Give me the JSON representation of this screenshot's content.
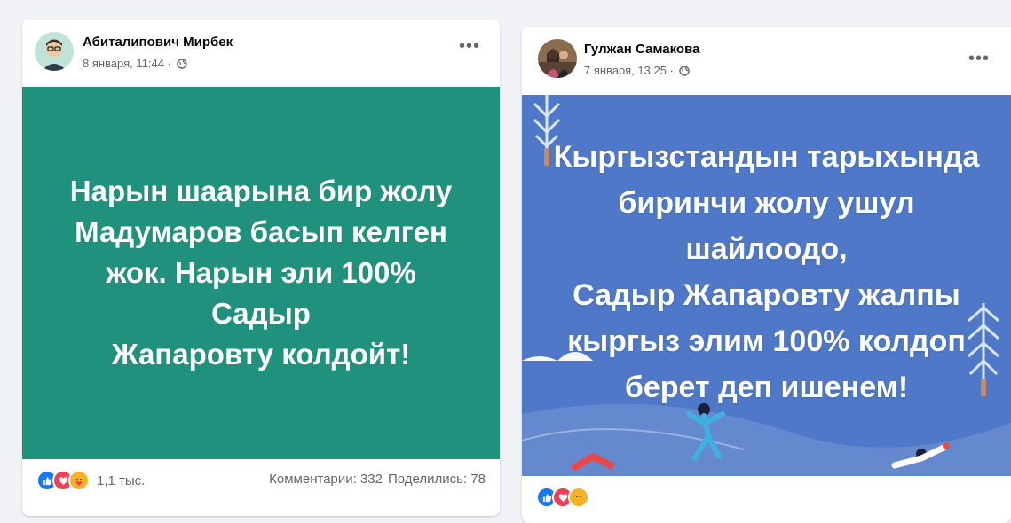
{
  "posts": [
    {
      "author": "Абиталипович Мирбек",
      "date": "8 января, 11:44 ·",
      "text": "Нарын шаарына бир жолу\nМадумаров басып келген\nжок. Нарын эли 100% Садыр\nЖапаровту колдойт!",
      "reactions_count": "1,1 тыс.",
      "comments": "Комментарии: 332",
      "shares": "Поделились: 78",
      "image_color": "#1f917c"
    },
    {
      "author": "Гулжан Самакова",
      "date": "7 января, 13:25 ·",
      "text": "Кыргызстандын тарыхында\nбиринчи жолу ушул\nшайлоодо,\nСадыр Жапаровту жалпы\nкыргыз элим 100% колдоп\nберет деп ишенем!",
      "image_color": "#4f79c8"
    }
  ],
  "icons": [
    "globe-icon",
    "more-options-icon",
    "like-icon",
    "love-icon",
    "care-icon"
  ],
  "colors": {
    "like": "#1877f2",
    "love": "#f33e58",
    "care": "#f7b125"
  }
}
